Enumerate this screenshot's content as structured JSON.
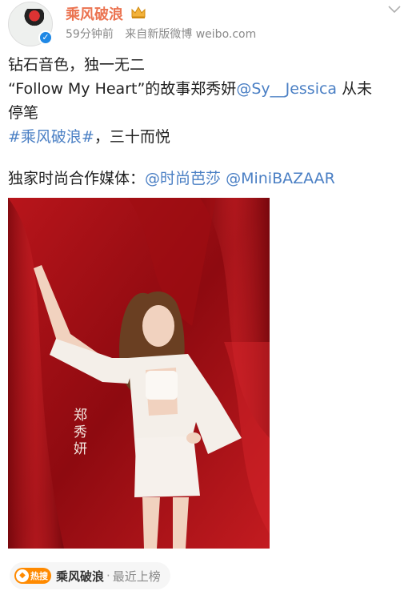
{
  "author": {
    "name": "乘风破浪",
    "time": "59分钟前",
    "source": "来自新版微博 weibo.com",
    "avatar_icon": "show-logo-icon",
    "verified_icon": "verified-check-icon",
    "crown_icon": "crown-icon"
  },
  "post": {
    "line1": "钻石音色，独一无二",
    "line2_pre": "“Follow My Heart”的故事郑秀妍",
    "line2_mention": "@Sy__Jessica",
    "line2_post": " 从未",
    "line3": "停笔",
    "hashtag": "#乘风破浪#",
    "line4_post": "，三十而悦",
    "media_label": "独家时尚合作媒体：",
    "media_mention1": "@时尚芭莎",
    "media_mention2": "@MiniBAZAAR"
  },
  "photo": {
    "signature_text": "郑秀妍"
  },
  "topic": {
    "badge": "热搜",
    "title": "乘风破浪",
    "separator": "·",
    "status": "最近上榜"
  },
  "colors": {
    "accent": "#eb7350",
    "link": "#4a7fc4",
    "meta": "#8a8a8a",
    "hot": "#ff8a00"
  }
}
